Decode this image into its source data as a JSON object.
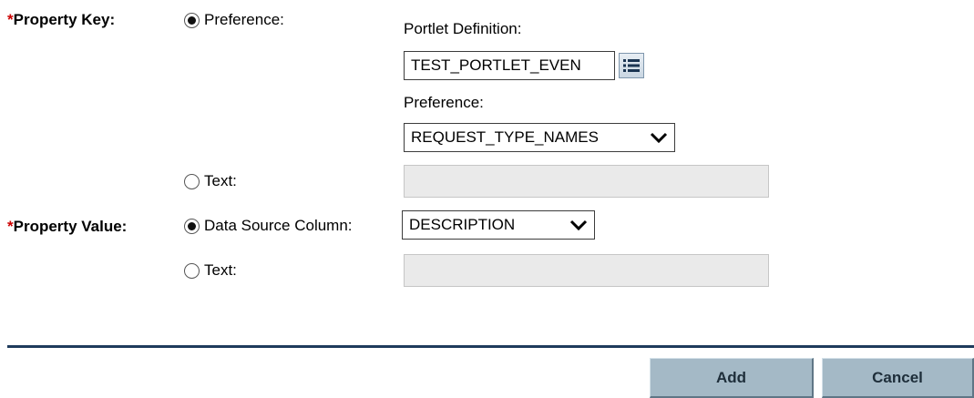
{
  "property_key": {
    "required_mark": "*",
    "label": "Property Key:",
    "preference_option": {
      "label": "Preference:",
      "selected": true
    },
    "portlet_definition": {
      "label": "Portlet Definition:",
      "value": "TEST_PORTLET_EVEN",
      "lookup_icon": "list-icon"
    },
    "preference": {
      "label": "Preference:",
      "selected_value": "REQUEST_TYPE_NAMES"
    },
    "text_option": {
      "label": "Text:",
      "selected": false,
      "value": ""
    }
  },
  "property_value": {
    "required_mark": "*",
    "label": "Property Value:",
    "data_source_option": {
      "label": "Data Source Column:",
      "selected": true,
      "selected_value": "DESCRIPTION"
    },
    "text_option": {
      "label": "Text:",
      "selected": false,
      "value": ""
    }
  },
  "actions": {
    "add_label": "Add",
    "cancel_label": "Cancel"
  },
  "colors": {
    "required": "#cc0000",
    "divider": "#1f3b5c",
    "button_bg": "#a4b9c6",
    "disabled_field": "#eaeaea"
  }
}
